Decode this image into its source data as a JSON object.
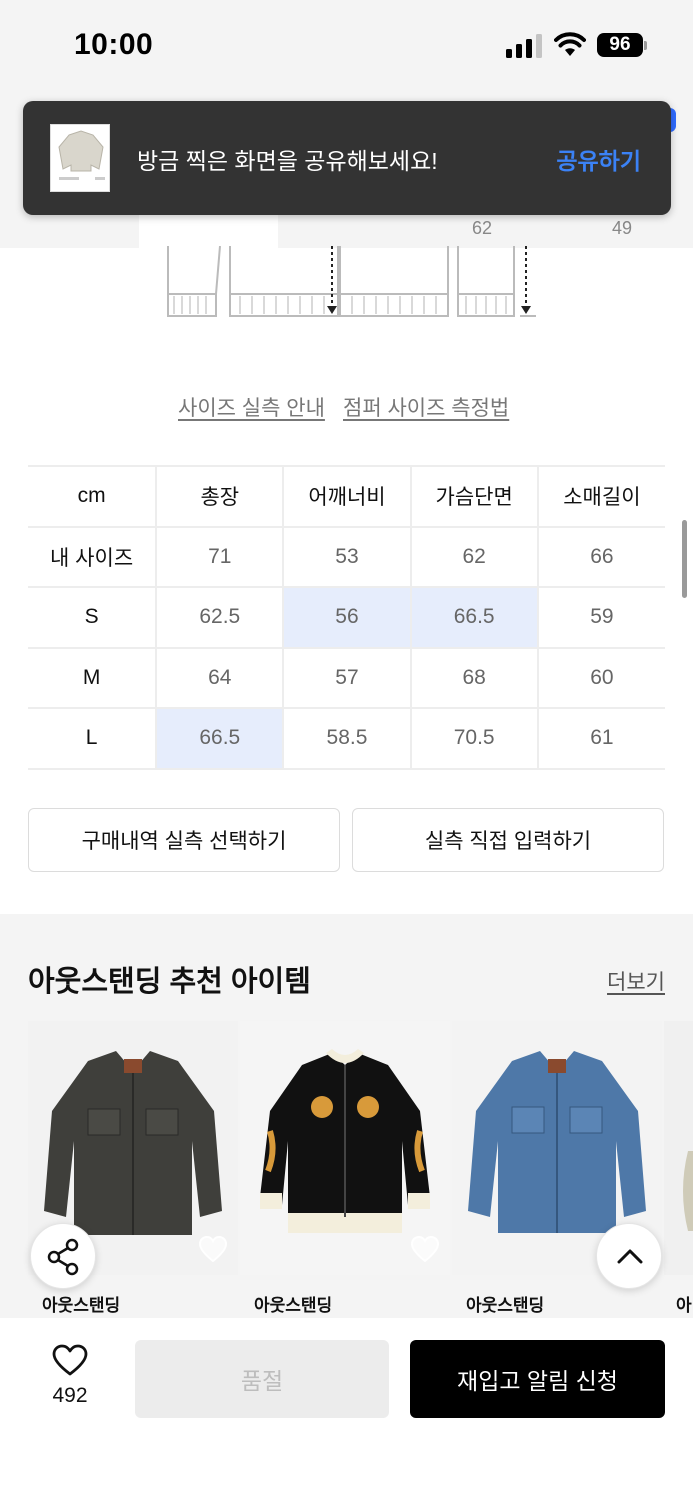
{
  "status_bar": {
    "time": "10:00",
    "battery": "96"
  },
  "toast": {
    "message": "방금 찍은 화면을 공유해보세요!",
    "action_label": "공유하기"
  },
  "tabs_partial": {
    "measure_62": "62",
    "measure_49": "49"
  },
  "guide_links": {
    "size_guide": "사이즈 실측 안내",
    "measure_method": "점퍼 사이즈 측정법"
  },
  "size_table": {
    "unit": "cm",
    "columns": [
      "총장",
      "어깨너비",
      "가슴단면",
      "소매길이"
    ],
    "rows": [
      {
        "label": "내 사이즈",
        "values": [
          "71",
          "53",
          "62",
          "66"
        ]
      },
      {
        "label": "S",
        "values": [
          "62.5",
          "56",
          "66.5",
          "59"
        ]
      },
      {
        "label": "M",
        "values": [
          "64",
          "57",
          "68",
          "60"
        ]
      },
      {
        "label": "L",
        "values": [
          "66.5",
          "58.5",
          "70.5",
          "61"
        ]
      }
    ]
  },
  "actions": {
    "select_purchase": "구매내역 실측 선택하기",
    "direct_input": "실측 직접 입력하기"
  },
  "recommended": {
    "title": "아웃스탠딩 추천 아이템",
    "more": "더보기",
    "items": [
      {
        "brand": "아웃스탠딩"
      },
      {
        "brand": "아웃스탠딩"
      },
      {
        "brand": "아웃스탠딩"
      },
      {
        "brand": "아"
      }
    ]
  },
  "bottom_bar": {
    "like_count": "492",
    "soldout_label": "품절",
    "restock_label": "재입고 알림 신청"
  },
  "colors": {
    "accent_blue": "#3b82f6",
    "highlight": "#e6edfc",
    "primary_button": "#000000"
  }
}
